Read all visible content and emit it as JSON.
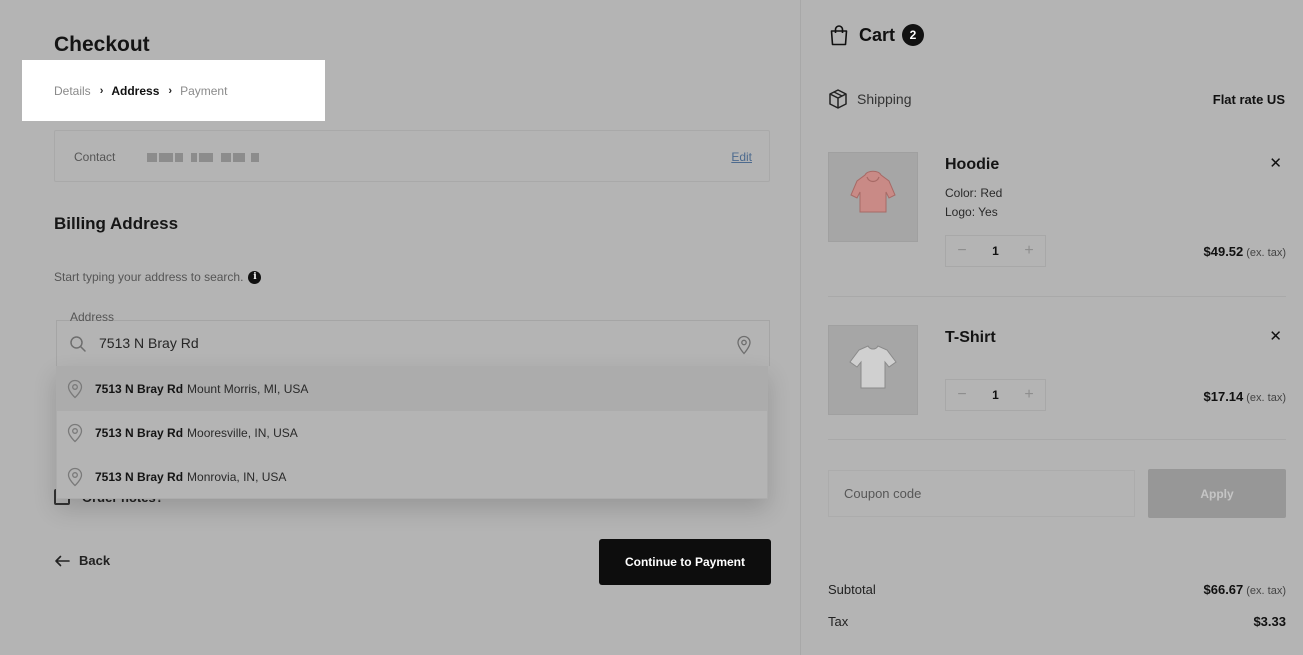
{
  "checkout": {
    "title": "Checkout",
    "breadcrumb": [
      {
        "label": "Details"
      },
      {
        "label": "Address"
      },
      {
        "label": "Payment"
      }
    ],
    "contact": {
      "label": "Contact",
      "edit_label": "Edit"
    },
    "billing": {
      "title": "Billing Address",
      "hint": "Start typing your address to search.",
      "address_label": "Address",
      "address_value": "7513 N Bray Rd"
    },
    "suggestions": [
      {
        "street": "7513 N Bray Rd",
        "locality": "Mount Morris, MI, USA"
      },
      {
        "street": "7513 N Bray Rd",
        "locality": "Mooresville, IN, USA"
      },
      {
        "street": "7513 N Bray Rd",
        "locality": "Monrovia, IN, USA"
      }
    ],
    "order_notes_label": "Order notes?",
    "back_label": "Back",
    "continue_label": "Continue to Payment"
  },
  "cart": {
    "title": "Cart",
    "count": "2",
    "shipping_label": "Shipping",
    "shipping_value": "Flat rate US",
    "items": [
      {
        "name": "Hoodie",
        "meta": [
          "Color: Red",
          "Logo: Yes"
        ],
        "qty": "1",
        "price": "$49.52",
        "price_suffix": "(ex. tax)"
      },
      {
        "name": "T-Shirt",
        "meta": [],
        "qty": "1",
        "price": "$17.14",
        "price_suffix": "(ex. tax)"
      }
    ],
    "coupon_placeholder": "Coupon code",
    "apply_label": "Apply",
    "subtotal_label": "Subtotal",
    "subtotal_value": "$66.67",
    "subtotal_suffix": "(ex. tax)",
    "tax_label": "Tax",
    "tax_value": "$3.33"
  },
  "colors": {
    "overlay_bg": "#b4b4b4",
    "highlight_bg": "#ffffff",
    "primary_button": "#0d0d0d",
    "link": "#4c6a8e"
  }
}
